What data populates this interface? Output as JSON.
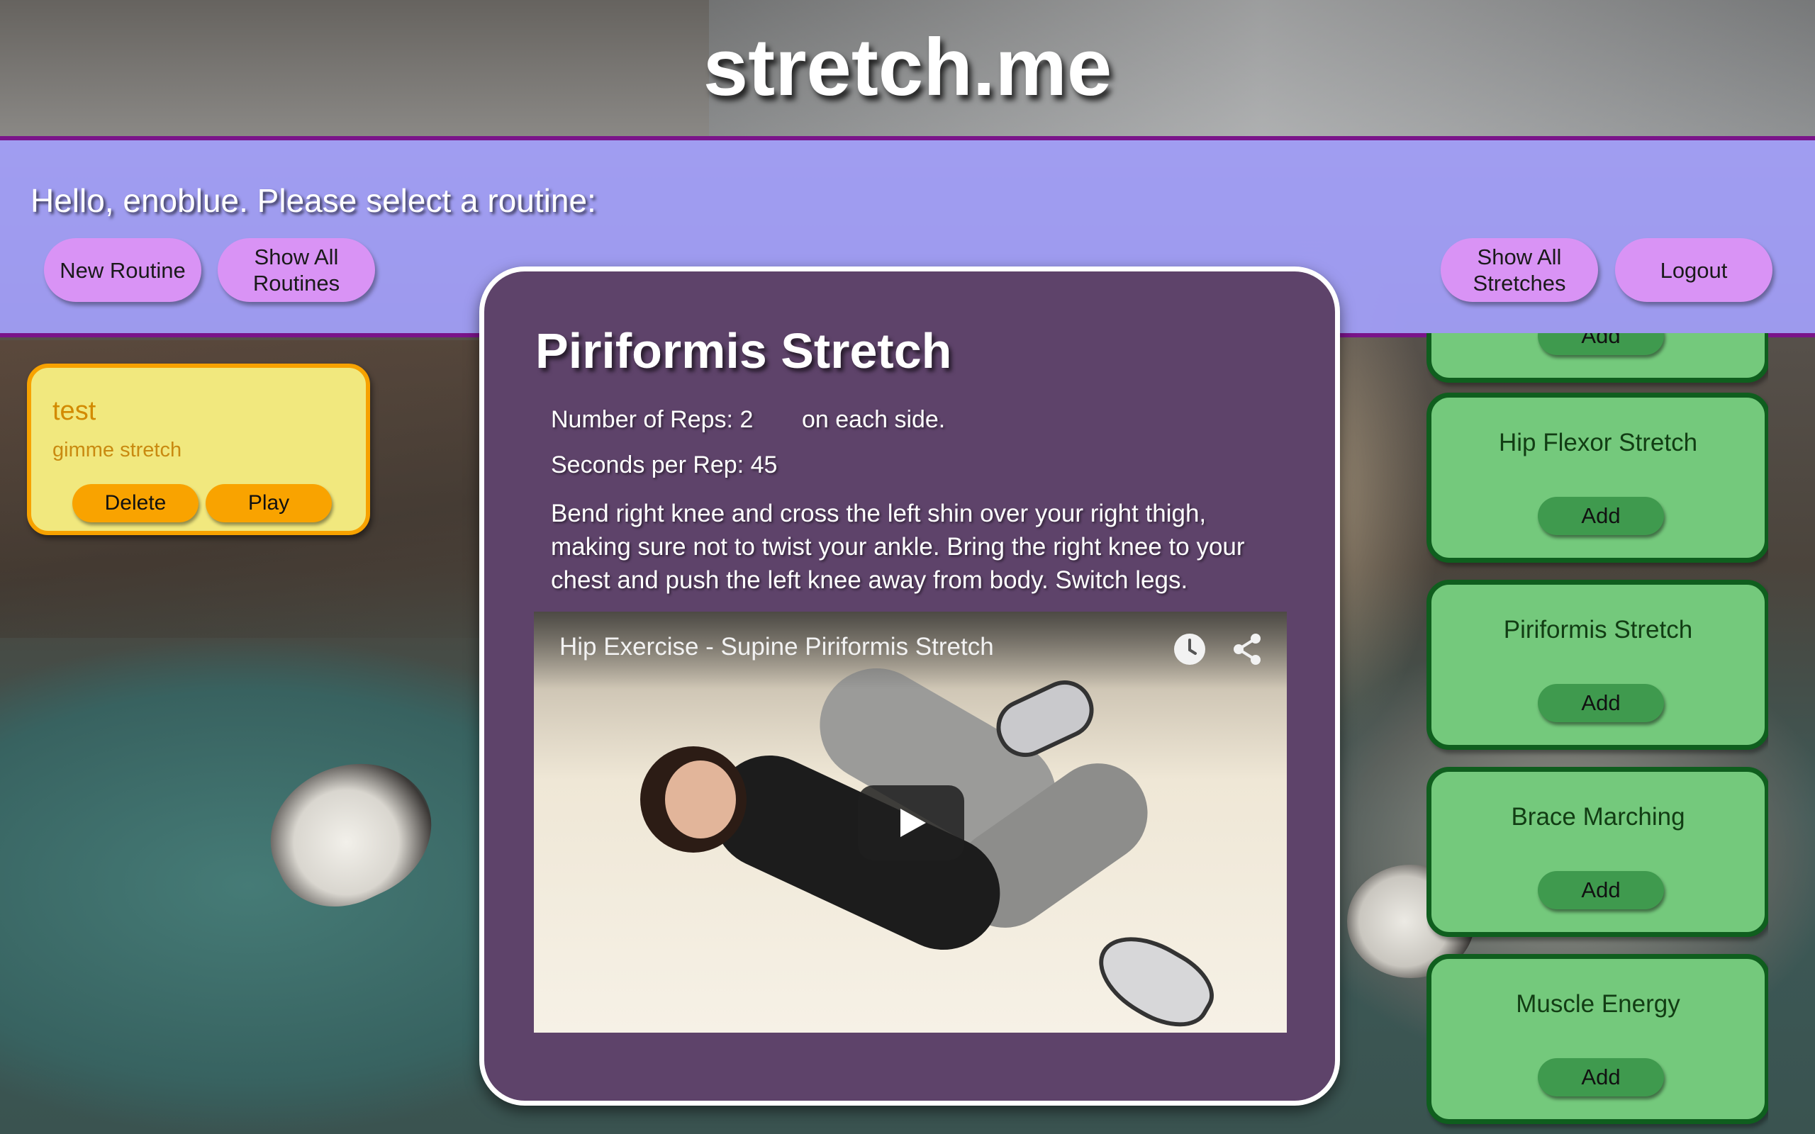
{
  "site": {
    "title": "stretch.me"
  },
  "header": {
    "greeting": "Hello, enoblue. Please select a routine:",
    "new_routine": "New Routine",
    "show_all_routines_line1": "Show All",
    "show_all_routines_line2": "Routines",
    "show_all_stretches_line1": "Show All",
    "show_all_stretches_line2": "Stretches",
    "logout": "Logout"
  },
  "routine": {
    "name": "test",
    "description": "gimme stretch",
    "delete": "Delete",
    "play": "Play"
  },
  "modal": {
    "title": "Piriformis Stretch",
    "reps": "Number of Reps: 2",
    "reps_note": "on each side.",
    "seconds": "Seconds per Rep: 45",
    "description": "Bend right knee and cross the left shin over your right thigh, making sure not to twist your ankle. Bring the right knee to your chest and push the left knee away from body. Switch legs.",
    "video_title": "Hip Exercise - Supine Piriformis Stretch"
  },
  "stretches": [
    {
      "name": "Hip Flexor Stretch",
      "add": "Add"
    },
    {
      "name": "Piriformis Stretch",
      "add": "Add"
    },
    {
      "name": "Brace Marching",
      "add": "Add"
    },
    {
      "name": "Muscle Energy",
      "add": "Add"
    }
  ],
  "stretch_partial_add": "Add",
  "colors": {
    "header_band": "#a29ef8",
    "header_border": "#7a148a",
    "pill_button": "#d993f5",
    "routine_card": "#f1e87e",
    "routine_border": "#f7a200",
    "stretch_card": "#74c97c",
    "stretch_border": "#0f5e1e",
    "modal_bg": "#5e436a"
  },
  "icons": {
    "clock": "clock-icon",
    "share": "share-icon",
    "play": "play-icon"
  }
}
